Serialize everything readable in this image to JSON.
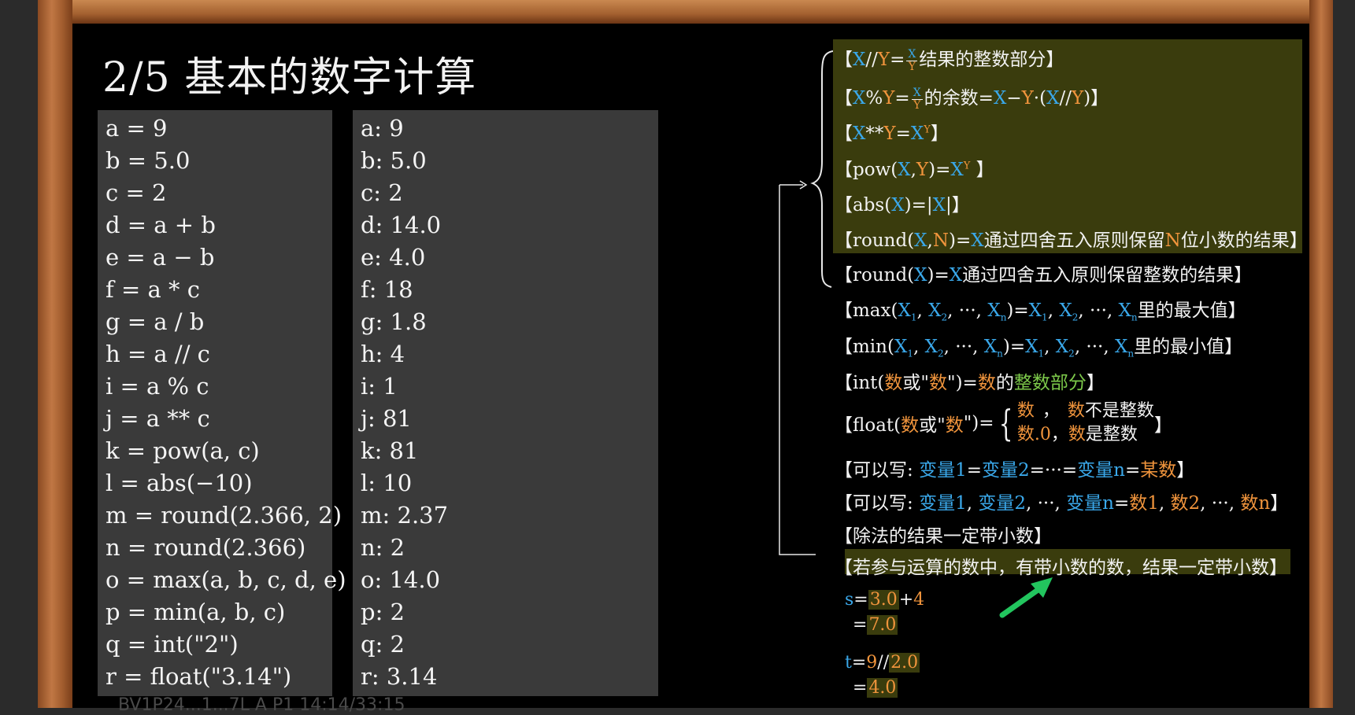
{
  "title": "2/5 基本的数字计算",
  "code_lines": [
    "a = 9",
    "b = 5.0",
    "c = 2",
    "d = a + b",
    "e = a − b",
    "f = a * c",
    "g = a / b",
    "h = a // c",
    "i = a % c",
    "j = a ** c",
    "k = pow(a, c)",
    "l = abs(−10)",
    "m = round(2.366, 2)",
    "n = round(2.366)",
    "o = max(a, b, c, d, e)",
    "p = min(a, b, c)",
    "q = int(\"2\")",
    "r = float(\"3.14\")"
  ],
  "output_lines": [
    "a: 9",
    "b: 5.0",
    "c: 2",
    "d: 14.0",
    "e: 4.0",
    "f: 18",
    "g: 1.8",
    "h: 4",
    "i: 1",
    "j: 81",
    "k: 81",
    "l: 10",
    "m: 2.37",
    "n: 2",
    "o: 14.0",
    "p: 2",
    "q: 2",
    "r: 3.14"
  ],
  "rules": {
    "floordiv": {
      "pre": "【",
      "x": "X",
      "op": "//",
      "y": "Y",
      "eq": "=",
      "fx": "X",
      "fy": "Y",
      "post": "结果的整数部分】"
    },
    "mod": {
      "pre": "【",
      "x": "X",
      "op": "%",
      "y": "Y",
      "eq": "=",
      "fx": "X",
      "fy": "Y",
      "mid": "的余数=",
      "x2": "X",
      "minus": "−",
      "y2": "Y",
      "dot": "·(",
      "x3": "X",
      "op2": "//",
      "y3": "Y",
      "post": ")】"
    },
    "power": {
      "pre": "【",
      "x": "X",
      "op": "**",
      "y": "Y",
      "eq": "=",
      "x2": "X",
      "sup": "Y",
      "post": "】"
    },
    "pow": {
      "pre": "【pow(",
      "x": "X",
      "comma": ",",
      "y": "Y",
      "eq": ")=",
      "x2": "X",
      "sup": "Y",
      "post": " 】"
    },
    "abs": {
      "pre": "【abs(",
      "x": "X",
      "eq": ")=|",
      "x2": "X",
      "post": "|】"
    },
    "round2": {
      "pre": "【round(",
      "x": "X",
      "comma": ",",
      "n": "N",
      "eq": ")=",
      "x2": "X",
      "mid": "通过四舍五入原则保留",
      "n2": "N",
      "post": "位小数的结果】"
    },
    "round1": {
      "pre": "【round(",
      "x": "X",
      "eq": ")=",
      "x2": "X",
      "post": "通过四舍五入原则保留整数的结果】"
    },
    "max": {
      "pre": "【max(",
      "x1": "X",
      "s1": "1",
      ", ": ", ",
      "x2": "X",
      "s2": "2",
      "dots": ", ···, ",
      "xn": "X",
      "sn": "n",
      "eq": ")=",
      "post": "里的最大值】"
    },
    "min": {
      "pre": "【min(",
      "x1": "X",
      "s1": "1",
      "x2": "X",
      "s2": "2",
      "xn": "X",
      "sn": "n",
      "eq": ")=",
      "post": "里的最小值】"
    },
    "int": {
      "pre": "【int(",
      "n1": "数",
      "or": "或\"",
      "n2": "数",
      "eq": "\")=",
      "n3": "数",
      "of": "的",
      "part": "整数部分",
      "post": "】"
    },
    "float": {
      "pre": "【float(",
      "n1": "数",
      "or": "或\"",
      "n2": "数",
      "eq": "\")=",
      "c1a": "数",
      "c1b": "，",
      "c1c": "数",
      "c1d": "不是整数",
      "c2a": "数",
      "c2b": ".0",
      "c2c": "，",
      "c2d": "数",
      "c2e": "是整数",
      "post": "】"
    },
    "chain": {
      "pre": "【可以写: ",
      "v1": "变量1",
      "e1": "=",
      "v2": "变量2",
      "e2": "=···=",
      "vn": "变量n",
      "e3": "=",
      "val": "某数",
      "post": "】"
    },
    "multi": {
      "pre": "【可以写: ",
      "v1": "变量1",
      "c1": ", ",
      "v2": "变量2",
      "c2": ", ···, ",
      "vn": "变量n",
      "eq": "=",
      "n1": "数1",
      "c3": ", ",
      "n2": "数2",
      "c4": ", ···, ",
      "nn": "数n",
      "post": "】"
    },
    "div": "【除法的结果一定带小数】",
    "mixed": {
      "pre": "【",
      "body": "若参与运算的数中，有带小数的数，结果一定带小数",
      "post": "】"
    }
  },
  "examples": {
    "s": {
      "var": "s",
      "eq": "=",
      "a": "3.0",
      "op": "+",
      "b": "4",
      "eq2": "=",
      "res": "7.0"
    },
    "t": {
      "var": "t",
      "eq": "=",
      "a": "9",
      "op": "//",
      "b": "2.0",
      "eq2": "=",
      "res": "4.0"
    }
  },
  "watermark": "BV1P24...1...7L A P1 14:14/33:15",
  "colors": {
    "blue": "#3aa8ea",
    "orange": "#f0943c",
    "green": "#7cc84a",
    "highlight": "#3a3c0d"
  }
}
